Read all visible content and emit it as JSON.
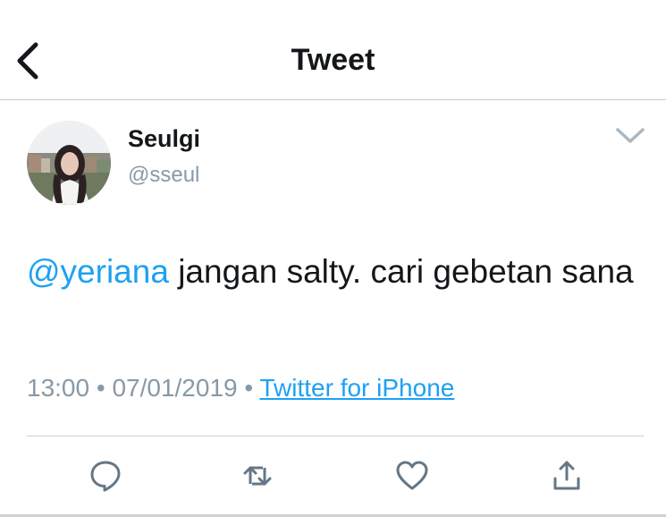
{
  "header": {
    "title": "Tweet",
    "back_icon": "chevron-left-icon"
  },
  "tweet": {
    "author_name": "Seulgi",
    "author_handle": "@sseul",
    "mention": "@yeriana",
    "text": " jangan salty. cari gebetan sana",
    "time": "13:00",
    "separator": "•",
    "date": "07/01/2019",
    "source": "Twitter for iPhone"
  },
  "actions": [
    "reply-icon",
    "retweet-icon",
    "like-icon",
    "share-icon"
  ],
  "colors": {
    "accent": "#1da1f2",
    "muted": "#8899a6",
    "icon": "#657786",
    "text": "#14171a"
  }
}
